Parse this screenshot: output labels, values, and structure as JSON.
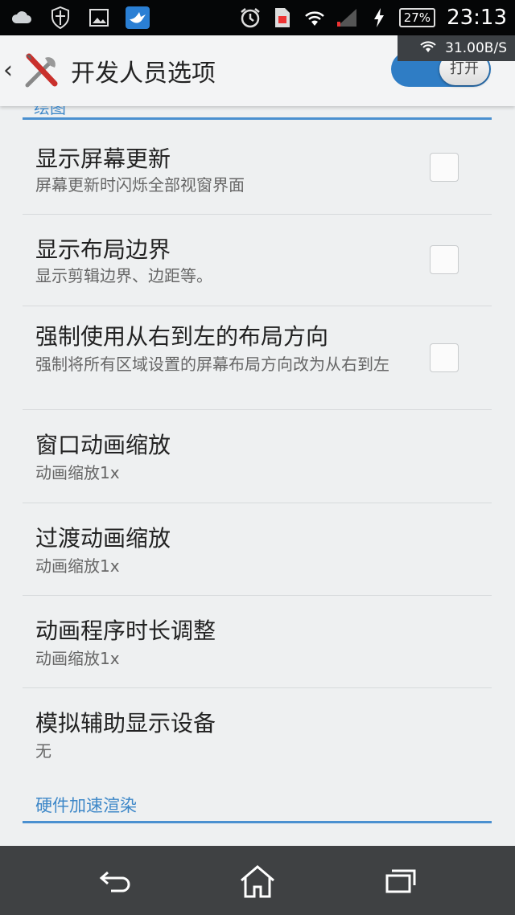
{
  "status_bar": {
    "time": "23:13",
    "battery": "27%",
    "net_speed": "31.00B/S",
    "icons": [
      "cloud-icon",
      "shield-icon",
      "image-icon",
      "bird-icon",
      "alarm-icon",
      "sim-icon",
      "wifi-icon",
      "signal-icon",
      "charging-icon"
    ]
  },
  "header": {
    "title": "开发人员选项",
    "toggle_label": "打开",
    "toggle_on": true
  },
  "section_top": {
    "label": "绘图"
  },
  "items": [
    {
      "title": "显示屏幕更新",
      "subtitle": "屏幕更新时闪烁全部视窗界面",
      "checked": false
    },
    {
      "title": "显示布局边界",
      "subtitle": "显示剪辑边界、边距等。",
      "checked": false
    },
    {
      "title": "强制使用从右到左的布局方向",
      "subtitle": "强制将所有区域设置的屏幕布局方向改为从右到左",
      "checked": false
    },
    {
      "title": "窗口动画缩放",
      "subtitle": "动画缩放1x"
    },
    {
      "title": "过渡动画缩放",
      "subtitle": "动画缩放1x"
    },
    {
      "title": "动画程序时长调整",
      "subtitle": "动画缩放1x"
    },
    {
      "title": "模拟辅助显示设备",
      "subtitle": "无"
    }
  ],
  "section_bottom": {
    "label": "硬件加速渲染"
  },
  "colors": {
    "accent": "#4a90d0",
    "toggle": "#2f7dc5",
    "status_bar": "#050607",
    "nav_bar": "#3f4143"
  }
}
